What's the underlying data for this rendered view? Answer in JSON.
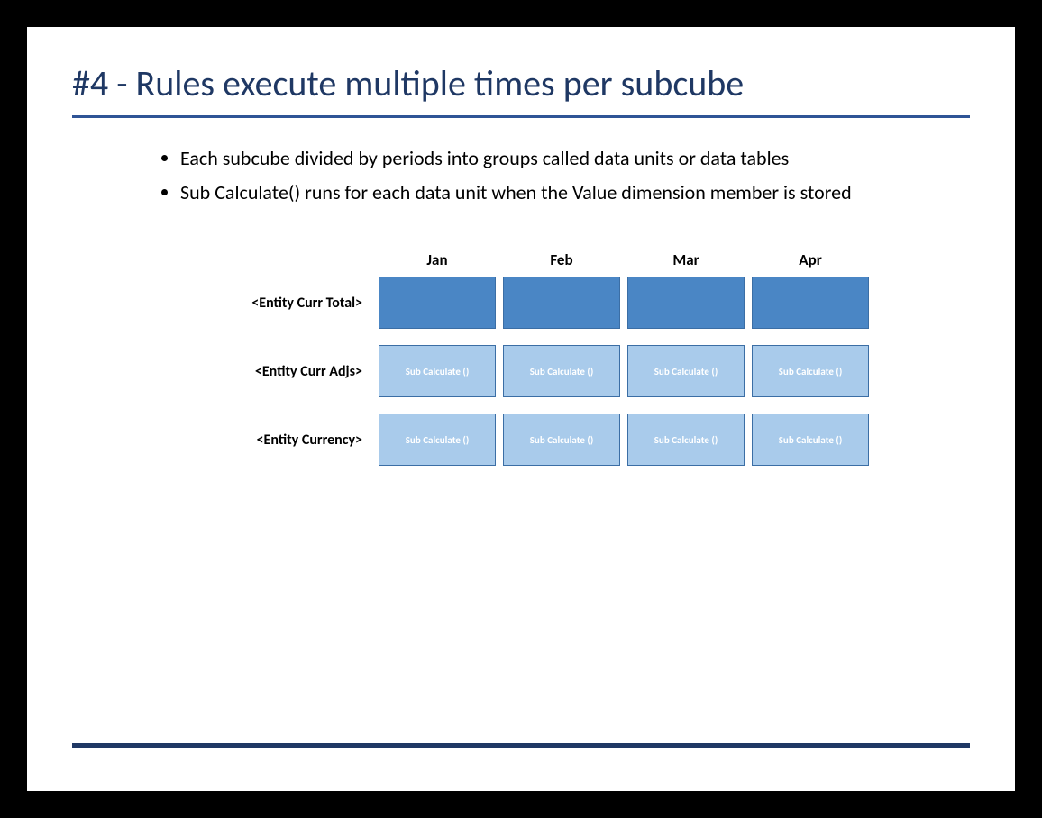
{
  "title": "#4 - Rules execute multiple times per subcube",
  "bullets": [
    "Each subcube divided by periods into groups called data units or data tables",
    "Sub Calculate() runs for each data unit when the Value dimension member is stored"
  ],
  "columns": [
    "Jan",
    "Feb",
    "Mar",
    "Apr"
  ],
  "rows": [
    {
      "label": "<Entity Curr Total>",
      "style": "dark",
      "cells": [
        "",
        "",
        "",
        ""
      ]
    },
    {
      "label": "<Entity Curr Adjs>",
      "style": "light",
      "cells": [
        "Sub Calculate ()",
        "Sub Calculate ()",
        "Sub Calculate ()",
        "Sub Calculate ()"
      ]
    },
    {
      "label": "<Entity Currency>",
      "style": "light",
      "cells": [
        "Sub Calculate ()",
        "Sub Calculate ()",
        "Sub Calculate ()",
        "Sub Calculate ()"
      ]
    }
  ]
}
